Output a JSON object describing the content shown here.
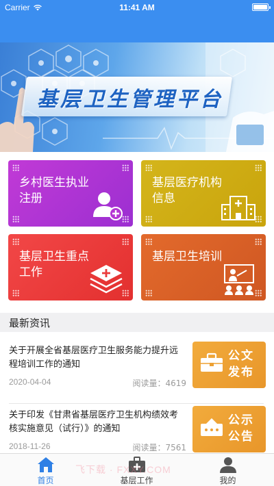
{
  "status_bar": {
    "carrier": "Carrier",
    "time": "11:41 AM"
  },
  "banner": {
    "title": "基层卫生管理平台"
  },
  "tiles": [
    {
      "label": "乡村医生执业注册",
      "icon": "add-user-icon",
      "color": "#b537d4"
    },
    {
      "label": "基层医疗机构信息",
      "icon": "hospital-building-icon",
      "color": "#cfae14"
    },
    {
      "label": "基层卫生重点工作",
      "icon": "layers-medical-icon",
      "color": "#ea3a3a"
    },
    {
      "label": "基层卫生培训",
      "icon": "classroom-training-icon",
      "color": "#d9602a"
    }
  ],
  "news": {
    "section_title": "最新资讯",
    "items": [
      {
        "title": "关于开展全省基层医疗卫生服务能力提升远程培训工作的通知",
        "date": "2020-04-04",
        "reads_label": "阅读量：",
        "reads": "4619",
        "badge": "公文发布",
        "badge_icon": "briefcase-icon"
      },
      {
        "title": "关于印发《甘肃省基层医疗卫生机构绩效考核实施意见（试行）》的通知",
        "date": "2018-11-26",
        "reads_label": "阅读量：",
        "reads": "7561",
        "badge": "公示公告",
        "badge_icon": "notice-board-icon"
      }
    ]
  },
  "tabbar": {
    "items": [
      {
        "label": "首页",
        "icon": "home-icon",
        "active": true
      },
      {
        "label": "基层工作",
        "icon": "medical-kit-icon",
        "active": false
      },
      {
        "label": "我的",
        "icon": "person-icon",
        "active": false
      }
    ]
  },
  "watermark": "飞下载 · FXXY.COM",
  "colors": {
    "header": "#3b8ef0",
    "accent": "#2f80e5",
    "badge": "#eda033"
  }
}
